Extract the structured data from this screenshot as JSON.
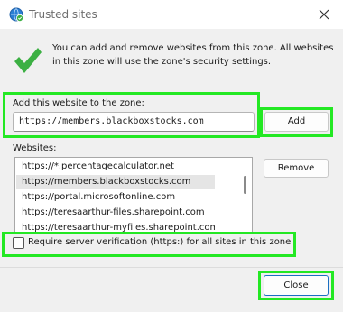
{
  "window": {
    "title": "Trusted sites",
    "title_icon": "globe-check-icon",
    "close_icon": "close-icon"
  },
  "info": {
    "icon": "checkmark-icon",
    "text": "You can add and remove websites from this zone. All websites in this zone will use the zone's security settings."
  },
  "add_site": {
    "label": "Add this website to the zone:",
    "value": "https://members.blackboxstocks.com",
    "add_button": "Add"
  },
  "websites": {
    "label": "Websites:",
    "items": [
      "https://*.percentagecalculator.net",
      "https://members.blackboxstocks.com",
      "https://portal.microsoftonline.com",
      "https://teresaarthur-files.sharepoint.com",
      "https://teresaarthur-myfiles.sharepoint.com"
    ],
    "selected_index": 1,
    "remove_button": "Remove"
  },
  "verification": {
    "label": "Require server verification (https:) for all sites in this zone",
    "checked": false
  },
  "footer": {
    "close_button": "Close"
  },
  "colors": {
    "highlight": "#23e823",
    "checkmark": "#3cb043",
    "selection": "#e5e5e5"
  }
}
